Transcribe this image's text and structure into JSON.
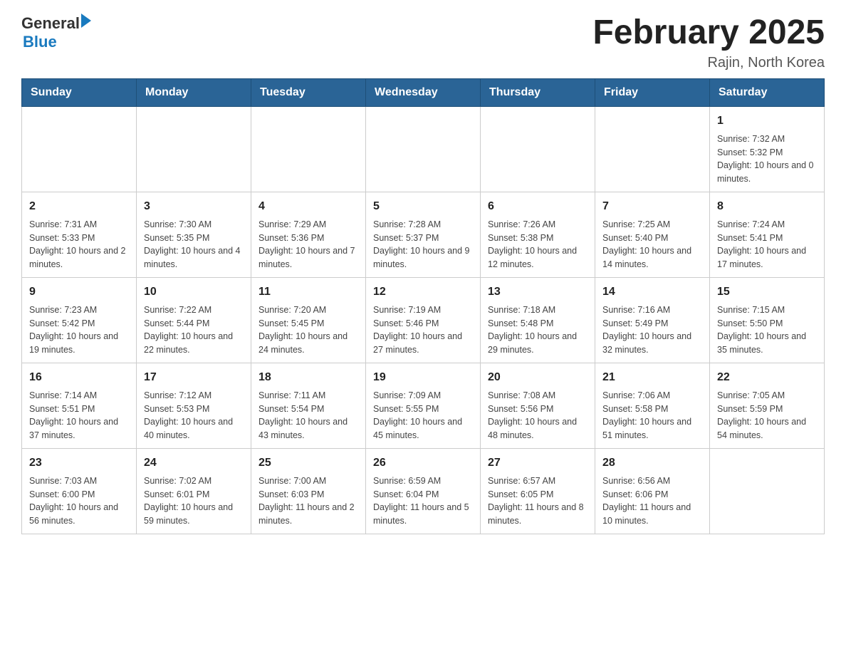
{
  "header": {
    "title": "February 2025",
    "subtitle": "Rajin, North Korea"
  },
  "logo": {
    "general": "General",
    "blue": "Blue"
  },
  "days_of_week": [
    "Sunday",
    "Monday",
    "Tuesday",
    "Wednesday",
    "Thursday",
    "Friday",
    "Saturday"
  ],
  "weeks": [
    [
      {
        "num": "",
        "info": ""
      },
      {
        "num": "",
        "info": ""
      },
      {
        "num": "",
        "info": ""
      },
      {
        "num": "",
        "info": ""
      },
      {
        "num": "",
        "info": ""
      },
      {
        "num": "",
        "info": ""
      },
      {
        "num": "1",
        "info": "Sunrise: 7:32 AM\nSunset: 5:32 PM\nDaylight: 10 hours and 0 minutes."
      }
    ],
    [
      {
        "num": "2",
        "info": "Sunrise: 7:31 AM\nSunset: 5:33 PM\nDaylight: 10 hours and 2 minutes."
      },
      {
        "num": "3",
        "info": "Sunrise: 7:30 AM\nSunset: 5:35 PM\nDaylight: 10 hours and 4 minutes."
      },
      {
        "num": "4",
        "info": "Sunrise: 7:29 AM\nSunset: 5:36 PM\nDaylight: 10 hours and 7 minutes."
      },
      {
        "num": "5",
        "info": "Sunrise: 7:28 AM\nSunset: 5:37 PM\nDaylight: 10 hours and 9 minutes."
      },
      {
        "num": "6",
        "info": "Sunrise: 7:26 AM\nSunset: 5:38 PM\nDaylight: 10 hours and 12 minutes."
      },
      {
        "num": "7",
        "info": "Sunrise: 7:25 AM\nSunset: 5:40 PM\nDaylight: 10 hours and 14 minutes."
      },
      {
        "num": "8",
        "info": "Sunrise: 7:24 AM\nSunset: 5:41 PM\nDaylight: 10 hours and 17 minutes."
      }
    ],
    [
      {
        "num": "9",
        "info": "Sunrise: 7:23 AM\nSunset: 5:42 PM\nDaylight: 10 hours and 19 minutes."
      },
      {
        "num": "10",
        "info": "Sunrise: 7:22 AM\nSunset: 5:44 PM\nDaylight: 10 hours and 22 minutes."
      },
      {
        "num": "11",
        "info": "Sunrise: 7:20 AM\nSunset: 5:45 PM\nDaylight: 10 hours and 24 minutes."
      },
      {
        "num": "12",
        "info": "Sunrise: 7:19 AM\nSunset: 5:46 PM\nDaylight: 10 hours and 27 minutes."
      },
      {
        "num": "13",
        "info": "Sunrise: 7:18 AM\nSunset: 5:48 PM\nDaylight: 10 hours and 29 minutes."
      },
      {
        "num": "14",
        "info": "Sunrise: 7:16 AM\nSunset: 5:49 PM\nDaylight: 10 hours and 32 minutes."
      },
      {
        "num": "15",
        "info": "Sunrise: 7:15 AM\nSunset: 5:50 PM\nDaylight: 10 hours and 35 minutes."
      }
    ],
    [
      {
        "num": "16",
        "info": "Sunrise: 7:14 AM\nSunset: 5:51 PM\nDaylight: 10 hours and 37 minutes."
      },
      {
        "num": "17",
        "info": "Sunrise: 7:12 AM\nSunset: 5:53 PM\nDaylight: 10 hours and 40 minutes."
      },
      {
        "num": "18",
        "info": "Sunrise: 7:11 AM\nSunset: 5:54 PM\nDaylight: 10 hours and 43 minutes."
      },
      {
        "num": "19",
        "info": "Sunrise: 7:09 AM\nSunset: 5:55 PM\nDaylight: 10 hours and 45 minutes."
      },
      {
        "num": "20",
        "info": "Sunrise: 7:08 AM\nSunset: 5:56 PM\nDaylight: 10 hours and 48 minutes."
      },
      {
        "num": "21",
        "info": "Sunrise: 7:06 AM\nSunset: 5:58 PM\nDaylight: 10 hours and 51 minutes."
      },
      {
        "num": "22",
        "info": "Sunrise: 7:05 AM\nSunset: 5:59 PM\nDaylight: 10 hours and 54 minutes."
      }
    ],
    [
      {
        "num": "23",
        "info": "Sunrise: 7:03 AM\nSunset: 6:00 PM\nDaylight: 10 hours and 56 minutes."
      },
      {
        "num": "24",
        "info": "Sunrise: 7:02 AM\nSunset: 6:01 PM\nDaylight: 10 hours and 59 minutes."
      },
      {
        "num": "25",
        "info": "Sunrise: 7:00 AM\nSunset: 6:03 PM\nDaylight: 11 hours and 2 minutes."
      },
      {
        "num": "26",
        "info": "Sunrise: 6:59 AM\nSunset: 6:04 PM\nDaylight: 11 hours and 5 minutes."
      },
      {
        "num": "27",
        "info": "Sunrise: 6:57 AM\nSunset: 6:05 PM\nDaylight: 11 hours and 8 minutes."
      },
      {
        "num": "28",
        "info": "Sunrise: 6:56 AM\nSunset: 6:06 PM\nDaylight: 11 hours and 10 minutes."
      },
      {
        "num": "",
        "info": ""
      }
    ]
  ]
}
